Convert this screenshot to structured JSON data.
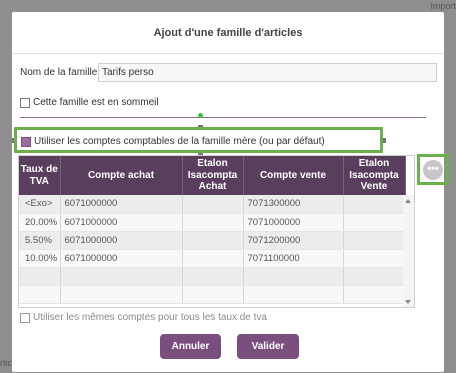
{
  "background": {
    "top_text": "Import",
    "left_text": "rtic"
  },
  "dialog": {
    "title": "Ajout d'une famille d'articles",
    "name_label": "Nom de la famille",
    "name_value": "Tarifs perso",
    "sleep_label": "Cette famille est en sommeil",
    "sleep_checked": false,
    "parent_accounts_label": "Utiliser les comptes comptables de la famille mère (ou par défaut)",
    "parent_accounts_checked": true,
    "more_button": "•••",
    "table": {
      "headers": [
        "Taux de TVA",
        "Compte achat",
        "Etalon Isacompta Achat",
        "Compte vente",
        "Etalon Isacompta Vente"
      ],
      "rows": [
        [
          "<Exo>",
          "6071000000",
          "",
          "7071300000",
          ""
        ],
        [
          "20.00%",
          "6071000000",
          "",
          "7071000000",
          ""
        ],
        [
          "5.50%",
          "6071000000",
          "",
          "7071200000",
          ""
        ],
        [
          "10.00%",
          "6071000000",
          "",
          "7071100000",
          ""
        ],
        [
          "",
          "",
          "",
          "",
          ""
        ],
        [
          "",
          "",
          "",
          "",
          ""
        ]
      ]
    },
    "same_accounts_label": "Utiliser les mêmes comptes pour tous les taux de tva",
    "same_accounts_checked": false,
    "cancel_label": "Annuler",
    "ok_label": "Valider"
  },
  "colors": {
    "header_bg": "#5a3e5d",
    "button_bg": "#7a4f7e",
    "highlight": "#6bb04a"
  }
}
